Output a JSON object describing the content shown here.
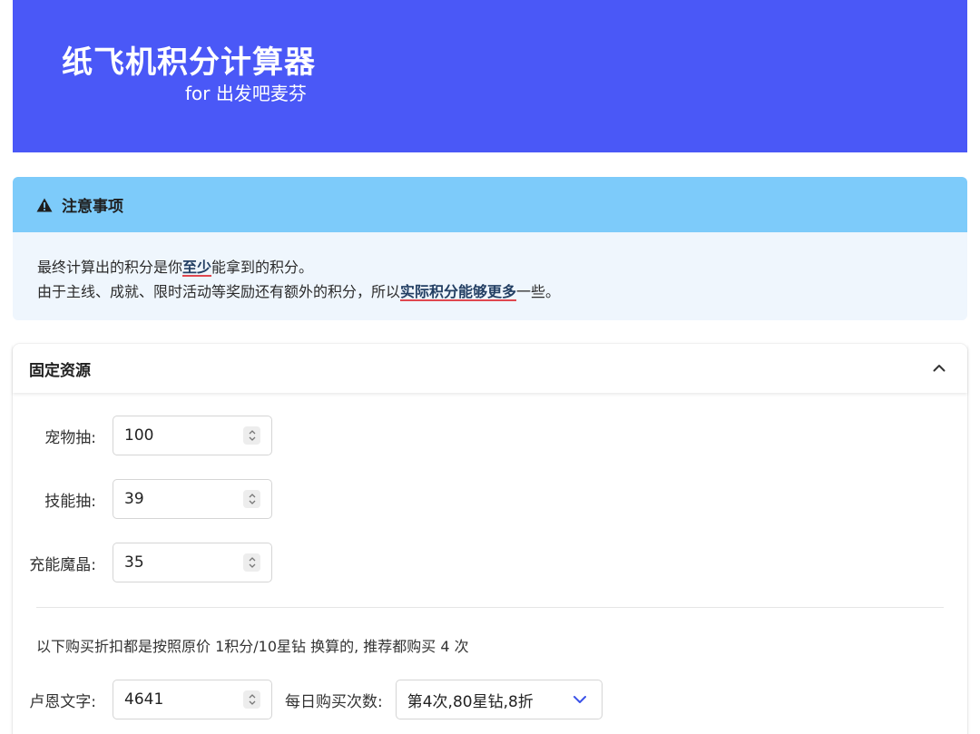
{
  "header": {
    "title": "纸飞机积分计算器",
    "subtitle": "for 出发吧麦芬"
  },
  "notice": {
    "title": "注意事项",
    "line1_pre": "最终计算出的积分是你",
    "line1_emph": "至少",
    "line1_post": "能拿到的积分。",
    "line2_pre": "由于主线、成就、限时活动等奖励还有额外的积分，所以",
    "line2_emph": "实际积分能够更多",
    "line2_post": "一些。"
  },
  "fixed_resources": {
    "title": "固定资源",
    "fields": [
      {
        "label": "宠物抽:",
        "value": "100"
      },
      {
        "label": "技能抽:",
        "value": "39"
      },
      {
        "label": "充能魔晶:",
        "value": "35"
      }
    ],
    "info": "以下购买折扣都是按照原价 1积分/10星钻 换算的, 推荐都购买 4 次",
    "purchase": {
      "label": "卢恩文字:",
      "value": "4641",
      "daily_label": "每日购买次数:",
      "daily_value": "第4次,80星钻,8折"
    }
  },
  "colors": {
    "hero": "#4a58f7",
    "notice_header": "#7dcbfa",
    "notice_body": "#eff6fd"
  }
}
